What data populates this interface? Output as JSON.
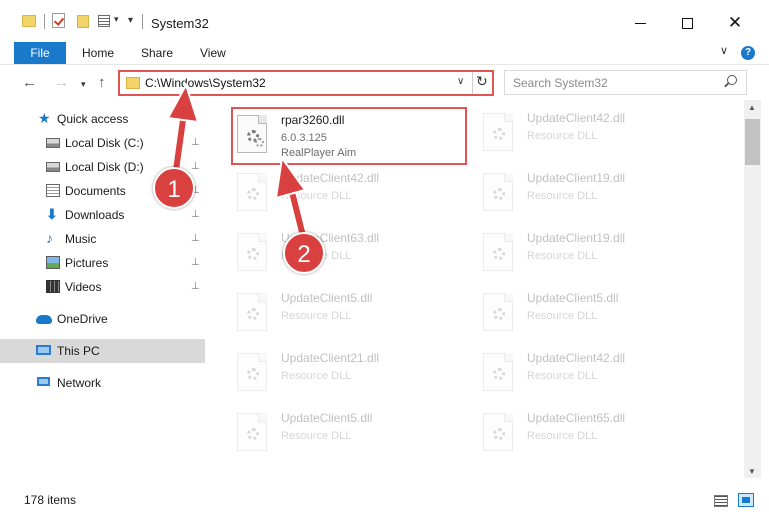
{
  "window": {
    "title": "System32",
    "minimize_label": "",
    "maximize_label": "",
    "close_label": "✕"
  },
  "ribbon": {
    "file": "File",
    "home": "Home",
    "share": "Share",
    "view": "View",
    "help": "?",
    "expand": "∨"
  },
  "nav": {
    "back": "←",
    "forward": "→",
    "recent": "▾",
    "up": "↑"
  },
  "address": {
    "path": "C:\\Windows\\System32",
    "dropdown": "∨",
    "refresh": "↻"
  },
  "search": {
    "placeholder": "Search System32"
  },
  "sidebar": {
    "items": [
      {
        "label": "Quick access",
        "icon": "star-icon",
        "pinned": false
      },
      {
        "label": "Local Disk (C:)",
        "icon": "disk-icon",
        "pinned": true
      },
      {
        "label": "Local Disk (D:)",
        "icon": "disk-icon",
        "pinned": true
      },
      {
        "label": "Documents",
        "icon": "documents-icon",
        "pinned": true
      },
      {
        "label": "Downloads",
        "icon": "downloads-icon",
        "pinned": true
      },
      {
        "label": "Music",
        "icon": "music-icon",
        "pinned": true
      },
      {
        "label": "Pictures",
        "icon": "pictures-icon",
        "pinned": true
      },
      {
        "label": "Videos",
        "icon": "videos-icon",
        "pinned": true
      },
      {
        "label": "OneDrive",
        "icon": "onedrive-icon",
        "pinned": false
      },
      {
        "label": "This PC",
        "icon": "pc-icon",
        "pinned": false,
        "selected": true
      },
      {
        "label": "Network",
        "icon": "network-icon",
        "pinned": false
      }
    ],
    "pin_glyph": "📌"
  },
  "files": {
    "left": [
      {
        "name": "rpar3260.dll",
        "line1": "6.0.3.125",
        "line2": "RealPlayer Aim"
      },
      {
        "name": "UpdateClient42.dll",
        "line1": "Resource DLL",
        "line2": ""
      },
      {
        "name": "UpdateClient63.dll",
        "line1": "Resource DLL",
        "line2": ""
      },
      {
        "name": "UpdateClient5.dll",
        "line1": "Resource DLL",
        "line2": ""
      },
      {
        "name": "UpdateClient21.dll",
        "line1": "Resource DLL",
        "line2": ""
      },
      {
        "name": "UpdateClient5.dll",
        "line1": "Resource DLL",
        "line2": ""
      }
    ],
    "right": [
      {
        "name": "UpdateClient42.dll",
        "line1": "Resource DLL",
        "line2": ""
      },
      {
        "name": "UpdateClient19.dll",
        "line1": "Resource DLL",
        "line2": ""
      },
      {
        "name": "UpdateClient19.dll",
        "line1": "Resource DLL",
        "line2": ""
      },
      {
        "name": "UpdateClient5.dll",
        "line1": "Resource DLL",
        "line2": ""
      },
      {
        "name": "UpdateClient42.dll",
        "line1": "Resource DLL",
        "line2": ""
      },
      {
        "name": "UpdateClient65.dll",
        "line1": "Resource DLL",
        "line2": ""
      }
    ]
  },
  "status": {
    "item_count": "178 items"
  },
  "annotations": {
    "step1": "1",
    "step2": "2",
    "color": "#d94040"
  },
  "colors": {
    "accent": "#1979ca",
    "highlight_border": "#e05454",
    "selected_bg": "#d9d9d9"
  }
}
